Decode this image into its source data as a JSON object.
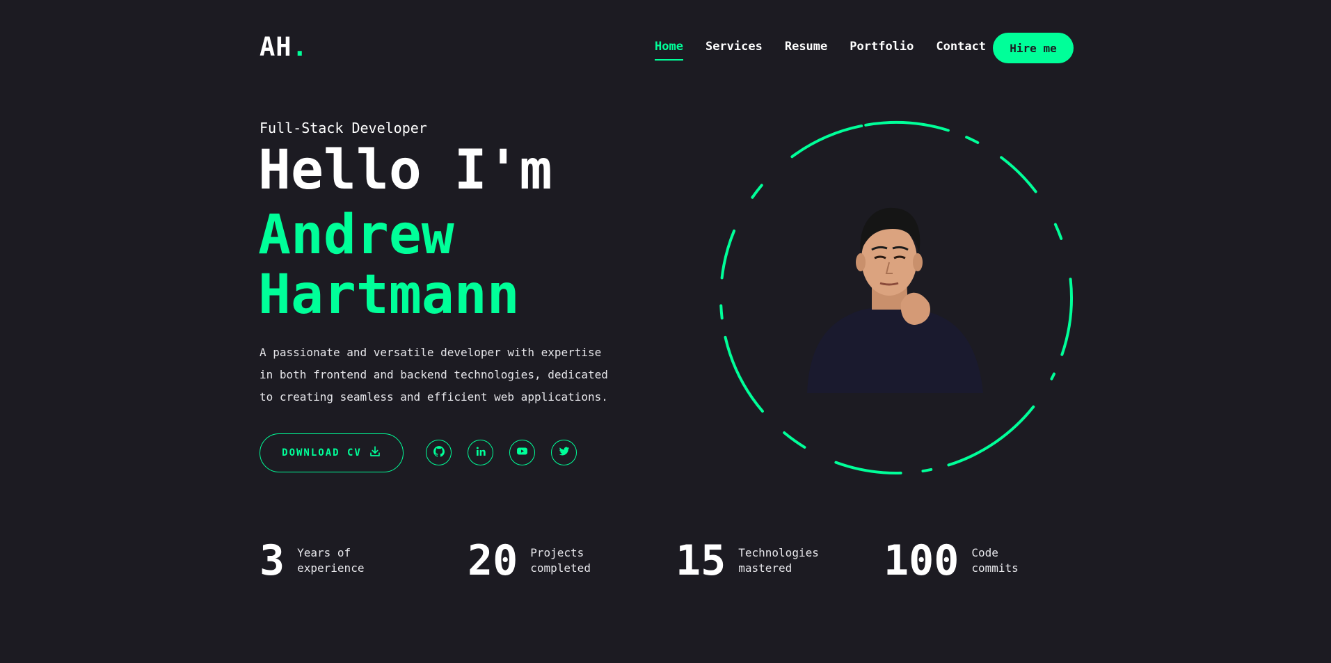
{
  "header": {
    "logo_text": "AH",
    "logo_dot": ".",
    "nav": [
      {
        "label": "Home",
        "active": true
      },
      {
        "label": "Services"
      },
      {
        "label": "Resume"
      },
      {
        "label": "Portfolio"
      },
      {
        "label": "Contact"
      }
    ],
    "hire_label": "Hire me"
  },
  "hero": {
    "role": "Full-Stack Developer",
    "greeting": "Hello I'm",
    "first_name": "Andrew",
    "last_name": "Hartmann",
    "bio_lines": [
      "A passionate and versatile developer with expertise",
      "in both frontend and backend technologies, dedicated",
      "to creating seamless and efficient web applications."
    ],
    "cv_label": "DOWNLOAD CV",
    "socials": [
      "github-icon",
      "linkedin-icon",
      "youtube-icon",
      "twitter-icon"
    ]
  },
  "stats": [
    {
      "num": "3",
      "line1": "Years of",
      "line2": "experience"
    },
    {
      "num": "20",
      "line1": "Projects",
      "line2": "completed"
    },
    {
      "num": "15",
      "line1": "Technologies",
      "line2": "mastered"
    },
    {
      "num": "100",
      "line1": "Code",
      "line2": "commits"
    }
  ],
  "colors": {
    "accent": "#00ff99",
    "background": "#1c1b22",
    "text": "#ffffff"
  }
}
